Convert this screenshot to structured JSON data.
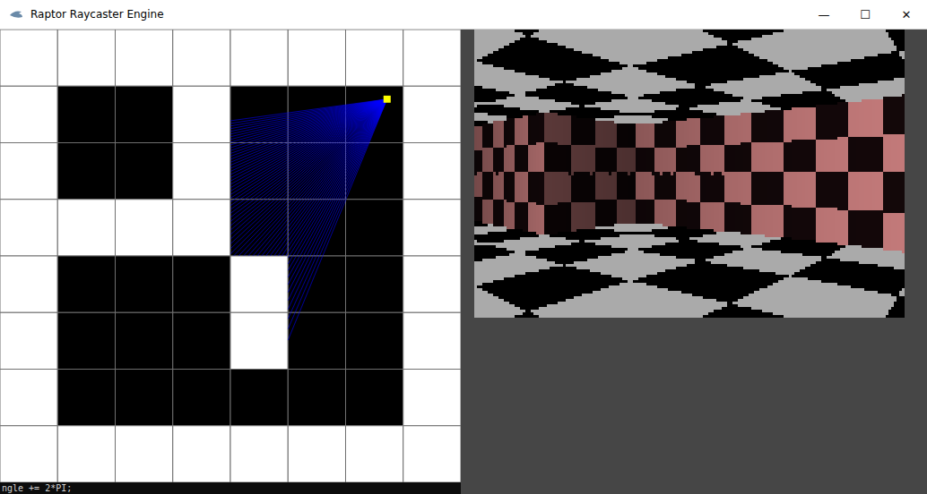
{
  "window": {
    "title": "Raptor Raycaster Engine",
    "controls": [
      "—",
      "☐",
      "✕"
    ]
  },
  "map": {
    "rows": [
      "11111111",
      "10010001",
      "10010001",
      "11110001",
      "10001001",
      "10001001",
      "10000001",
      "11111111"
    ]
  },
  "player": {
    "x": 6.72,
    "y": 1.23,
    "angle": 142
  },
  "fov": 60,
  "rays": 64,
  "console": {
    "text": "ngle += 2*PI;"
  }
}
